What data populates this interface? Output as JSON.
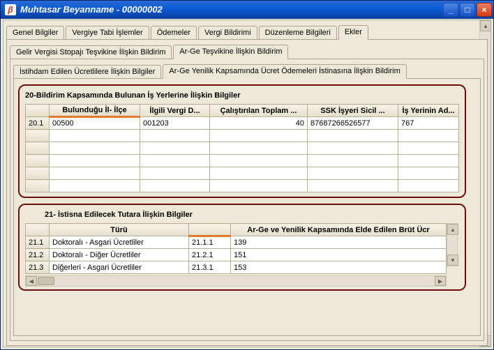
{
  "window": {
    "app_icon_glyph": "β",
    "title": "Muhtasar Beyanname - 00000002"
  },
  "tabs_main": {
    "genel": "Genel Bilgiler",
    "vergiye": "Vergiye Tabi İşlemler",
    "odemeler": "Ödemeler",
    "vergi_bildirimi": "Vergi Bildirimi",
    "duzenleme": "Düzenleme Bilgileri",
    "ekler": "Ekler"
  },
  "tabs_sub1": {
    "gelir": "Gelir Vergisi Stopajı Teşvikine İlişkin Bildirim",
    "arge": "Ar-Ge Teşvikine İlişkin Bildirim"
  },
  "tabs_sub2": {
    "istihdam": "İstihdam Edilen Ücretlilere İlişkin Bilgiler",
    "arge_yenilik": "Ar-Ge Yenilik Kapsamında Ücret Ödemeleri İstinasına İlişkin Bildirim"
  },
  "panel20": {
    "title": "20-Bildirim Kapsamında Bulunan İş Yerlerine İlişkin Bilgiler",
    "headers": {
      "h_blank": "",
      "h_il": "Bulunduğu İl- İlçe",
      "h_vergi": "İlgili Vergi D...",
      "h_toplam": "Çalıştırılan Toplam ...",
      "h_ssk": "SSK İşyeri Sicil ...",
      "h_ad": "İş Yerinin Ad..."
    },
    "rows": [
      {
        "no": "20.1",
        "il": "00500",
        "vergi": "001203",
        "toplam": "40",
        "ssk": "87687266526577",
        "ad": "767"
      }
    ]
  },
  "panel21": {
    "title": "21- İstisna Edilecek Tutara İlişkin Bilgiler",
    "headers": {
      "h_blank": "",
      "h_turu": "Türü",
      "h_code": "",
      "h_brut": "Ar-Ge ve Yenilik Kapsamında Elde Edilen Brüt Ücr"
    },
    "rows": [
      {
        "no": "21.1",
        "turu": "Doktoralı - Asgari Ücretliler",
        "code": "21.1.1",
        "brut": "139"
      },
      {
        "no": "21.2",
        "turu": "Doktoralı - Diğer Ücretliler",
        "code": "21.2.1",
        "brut": "151"
      },
      {
        "no": "21.3",
        "turu": "Diğerleri - Asgari Ücretliler",
        "code": "21.3.1",
        "brut": "153"
      }
    ]
  }
}
